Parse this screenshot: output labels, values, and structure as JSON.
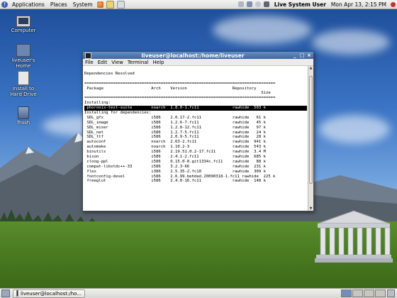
{
  "top_panel": {
    "menus": [
      "Applications",
      "Places",
      "System"
    ],
    "user": "Live System User",
    "clock": "Mon Apr 13,  2:15 PM"
  },
  "desktop": {
    "icons": [
      {
        "label": "Computer",
        "icon": "computer-icon"
      },
      {
        "label": "liveuser's Home",
        "icon": "home-folder-icon"
      },
      {
        "label": "Install to Hard Drive",
        "icon": "install-icon"
      },
      {
        "label": "Trash",
        "icon": "trash-icon"
      }
    ]
  },
  "window": {
    "title": "liveuser@localhost:/home/liveuser",
    "menu": [
      "File",
      "Edit",
      "View",
      "Terminal",
      "Help"
    ],
    "terminal_lines": [
      "",
      "Dependencies Resolved",
      "",
      "================================================================================",
      " Package                    Arch    Version                   Repository",
      "                                                                          Size",
      "================================================================================",
      "Installing:",
      " phoronix-test-suite        noarch  1.8.0-1.fc11              rawhide  503 k",
      "Installing for dependencies:",
      " SDL_gfx                    i586    2.0.17-2.fc11             rawhide   61 k",
      " SDL_image                  i586    1.2.6-7.fc11              rawhide   45 k",
      " SDL_mixer                  i586    1.2.8-12.fc11             rawhide   97 k",
      " SDL_net                    i586    1.2.7-5.fc11              rawhide   24 k",
      " SDL_ttf                    i586    2.0.9-5.fc11              rawhide   28 k",
      " autoconf                   noarch  2.63-2.fc11               rawhide  941 k",
      " automake                   noarch  1.10.2-3                  rawhide  543 k",
      " binutils                   i586    2.19.51.0.2-17.fc11       rawhide  3.4 M",
      " bison                      i586    2.4.1-2.fc11              rawhide  685 k",
      " cloog-ppl                  i586    0.15.0-8.git1334c.fc11    rawhide   88 k",
      " compat-libstdc++-33        i586    3.2.3-66                  rawhide  231 k",
      " flex                       i386    2.5.35-2.fc10             rawhide  309 k",
      " fontconfig-devel           i586    2.6.99.behdad.20090318-1.fc11 rawhide  225 k",
      " freeglut                   i586    2.4.0-16.fc11             rawhide  148 k"
    ],
    "highlight_index": 8
  },
  "bottom_panel": {
    "task_label": "liveuser@localhost:/ho..."
  },
  "colors": {
    "titlebar": "#4f76ad",
    "desktop_sky": "#3b74c4",
    "grass": "#4b7d22"
  }
}
